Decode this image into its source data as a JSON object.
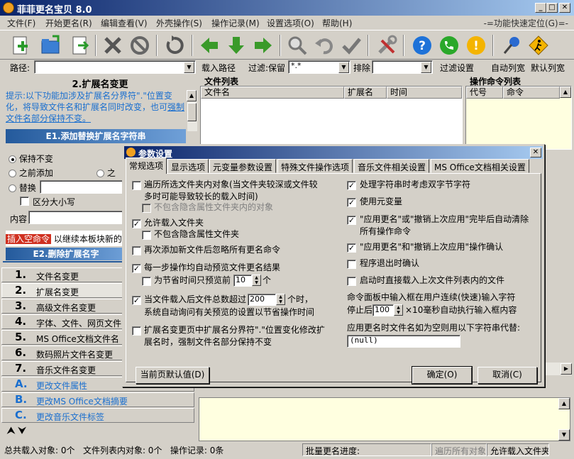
{
  "window": {
    "title": "菲菲更名宝贝 8.0",
    "min": "_",
    "max": "□",
    "close": "✕"
  },
  "menu": {
    "items": [
      "文件(F)",
      "开始更名(R)",
      "编辑查看(V)",
      "外壳操作(S)",
      "操作记录(M)",
      "设置选项(O)",
      "帮助(H)"
    ],
    "hint": "-=功能快速定位(G)=-"
  },
  "pathbar": {
    "path_label": "路径:",
    "load_path": "载入路径",
    "filter_label": "过滤:保留",
    "filter_value": "*.*",
    "exclude_label": "排除",
    "filter_settings": "过滤设置",
    "auto_width": "自动列宽",
    "default_width": "默认列宽"
  },
  "left": {
    "section_title": "2.扩展名变更",
    "tip_text": "提示:以下功能加涉及扩展名分界符\".\"位置变化，将导致文件名和扩展名同时改变，也可",
    "tip_link": "强制文件名部分保持不变。",
    "e1_header": "E1.添加替换扩展名字符串",
    "keep_unchanged": "保持不变",
    "prepend": "之前添加",
    "append_partial": "之",
    "replace": "替换",
    "case_sensitive": "区分大小写",
    "content_label": "内容",
    "insert_cmd": "插入空命令",
    "insert_cmd_rest": "以继续本板块新的",
    "e2_header": "E2.删除扩展名字",
    "nav": [
      {
        "num": "1.",
        "label": "文件名变更"
      },
      {
        "num": "2.",
        "label": "扩展名变更"
      },
      {
        "num": "3.",
        "label": "高级文件名变更"
      },
      {
        "num": "4.",
        "label": "字体、文件、网页文件"
      },
      {
        "num": "5.",
        "label": "MS Office文档文件名"
      },
      {
        "num": "6.",
        "label": "数码照片文件名变更"
      },
      {
        "num": "7.",
        "label": "音乐文件名变更"
      },
      {
        "num": "A.",
        "label": "更改文件属性"
      },
      {
        "num": "B.",
        "label": "更改MS Office文档摘要"
      },
      {
        "num": "C.",
        "label": "更改音乐文件标签"
      }
    ],
    "collapse_icons": "⮝ ⮟"
  },
  "filelist": {
    "title": "文件列表",
    "columns": [
      "文件名",
      "扩展名",
      "时间"
    ]
  },
  "cmdlist": {
    "title": "操作命令列表",
    "columns": [
      "代号",
      "命令"
    ]
  },
  "dialog": {
    "title": "参数设置",
    "close": "✕",
    "tabs": [
      "常规选项",
      "显示选项",
      "元变量参数设置",
      "特殊文件操作选项",
      "音乐文件相关设置",
      "MS Office文档相关设置"
    ],
    "left_options": [
      {
        "label": "遍历所选文件夹内对象(当文件夹较深或文件较多时可能导致较长的载入时间)",
        "checked": false
      },
      {
        "label": "不包含隐含属性文件夹内的对象",
        "checked": false,
        "disabled": true
      },
      {
        "label": "允许载入文件夹",
        "checked": true
      },
      {
        "label": "不包含隐含属性文件夹",
        "checked": false
      },
      {
        "label": "再次添加新文件后忽略所有更名命令",
        "checked": false
      },
      {
        "label": "每一步操作均自动预览文件更名结果",
        "checked": true
      },
      {
        "label": "为节省时间只预览前",
        "checked": false
      },
      {
        "label": "当文件载入后文件总数超过",
        "checked": true
      },
      {
        "label": "扩展名变更页中扩展名分界符\".\"位置变化修改扩展名时，强制文件名部分保持不变",
        "checked": false
      }
    ],
    "preview_count": "10",
    "preview_suffix": "个",
    "threshold": "200",
    "threshold_suffix": "个时，",
    "threshold_line2": "系统自动询问有关预览的设置以节省操作时间",
    "right_options": [
      {
        "label": "处理字符串时考虑双字节字符",
        "checked": true
      },
      {
        "label": "使用元变量",
        "checked": true
      },
      {
        "label": "\"应用更名\"或\"撤销上次应用\"完毕后自动清除所有操作命令",
        "checked": true
      },
      {
        "label": "\"应用更名\"和\"撤销上次应用\"操作确认",
        "checked": true
      },
      {
        "label": "程序退出时确认",
        "checked": false
      },
      {
        "label": "启动时直接载入上次文件列表内的文件",
        "checked": false
      }
    ],
    "typing_line1": "命令面板中输入框在用户连续(快速)输入字符",
    "typing_prefix": "停止后",
    "typing_value": "100",
    "typing_suffix": "×10毫秒自动执行输入框内容",
    "null_label": "应用更名时文件名如为空则用以下字符串代替:",
    "null_value": "(null)",
    "btn_default": "当前页默认值(D)",
    "btn_ok": "确定(O)",
    "btn_cancel": "取消(C)"
  },
  "status": {
    "total": "总共载入对象: 0个",
    "in_list": "文件列表内对象: 0个",
    "records": "操作记录: 0条",
    "progress": "批量更名进度:",
    "traverse": "遍历所有对象",
    "allow_folder": "允许载入文件夹"
  }
}
